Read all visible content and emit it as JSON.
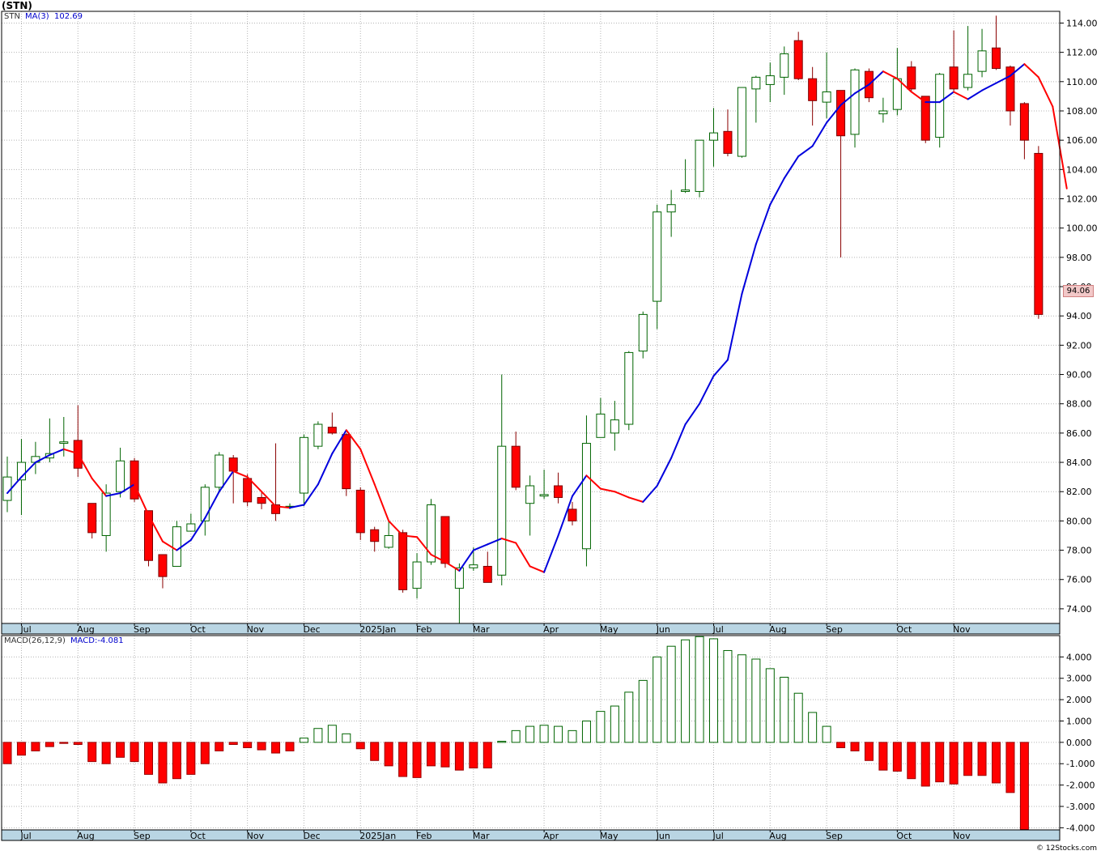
{
  "symbol": "(STN)",
  "footer": "© 12Stocks.com",
  "colors": {
    "up_outline": "#006400",
    "down_fill": "#ff0000",
    "ma_up": "#0000dd",
    "ma_down": "#ff0000",
    "grid": "#b4b4b4",
    "axis_strip": "#b9d5e3",
    "last_price_box": "#f2c8c8"
  },
  "price_panel": {
    "ticker_label": "STN",
    "ma_label": "MA(3)",
    "ma_value": "102.69",
    "last_price_label": "94.06",
    "y_ticks": [
      "74.00",
      "76.00",
      "78.00",
      "80.00",
      "82.00",
      "84.00",
      "86.00",
      "88.00",
      "90.00",
      "92.00",
      "94.00",
      "96.00",
      "98.00",
      "100.00",
      "102.00",
      "104.00",
      "106.00",
      "108.00",
      "110.00",
      "112.00",
      "114.00"
    ]
  },
  "macd_panel": {
    "label": "MACD(26,12,9)",
    "value_label": "MACD:-4.081",
    "y_ticks": [
      "-4.000",
      "-3.000",
      "-2.000",
      "-1.000",
      "0.000",
      "1.000",
      "2.000",
      "3.000",
      "4.000"
    ]
  },
  "x_axis": {
    "months": [
      "Jul",
      "Aug",
      "Sep",
      "Oct",
      "Nov",
      "Dec",
      "2025Jan",
      "Feb",
      "Mar",
      "Apr",
      "May",
      "Jun",
      "Jul",
      "Aug",
      "Sep",
      "Oct",
      "Nov"
    ],
    "month_week_index": [
      1,
      5,
      9,
      13,
      17,
      21,
      25,
      29,
      33,
      38,
      42,
      46,
      50,
      54,
      58,
      63,
      67
    ]
  },
  "chart_data": {
    "type": "candlestick",
    "title": "(STN)",
    "interval": "weekly",
    "ylim": [
      73,
      114.8
    ],
    "macd_ylim": [
      -4.1,
      5.0
    ],
    "candles": [
      {
        "o": 81.4,
        "h": 84.4,
        "l": 80.6,
        "c": 83.0
      },
      {
        "o": 82.8,
        "h": 85.6,
        "l": 80.4,
        "c": 84.0
      },
      {
        "o": 84.0,
        "h": 85.4,
        "l": 83.2,
        "c": 84.4
      },
      {
        "o": 84.3,
        "h": 87.0,
        "l": 84.0,
        "c": 84.6
      },
      {
        "o": 85.3,
        "h": 87.1,
        "l": 84.4,
        "c": 85.4
      },
      {
        "o": 85.5,
        "h": 87.9,
        "l": 83.0,
        "c": 83.6
      },
      {
        "o": 81.2,
        "h": 81.2,
        "l": 78.8,
        "c": 79.2
      },
      {
        "o": 79.0,
        "h": 82.5,
        "l": 77.9,
        "c": 81.9
      },
      {
        "o": 82.0,
        "h": 85.0,
        "l": 81.6,
        "c": 84.1
      },
      {
        "o": 84.1,
        "h": 84.3,
        "l": 81.3,
        "c": 81.5
      },
      {
        "o": 80.7,
        "h": 80.7,
        "l": 76.9,
        "c": 77.3
      },
      {
        "o": 77.7,
        "h": 77.7,
        "l": 75.4,
        "c": 76.2
      },
      {
        "o": 76.9,
        "h": 80.0,
        "l": 76.9,
        "c": 79.6
      },
      {
        "o": 79.3,
        "h": 80.5,
        "l": 79.3,
        "c": 79.8
      },
      {
        "o": 80.0,
        "h": 82.5,
        "l": 79.0,
        "c": 82.3
      },
      {
        "o": 82.3,
        "h": 84.7,
        "l": 82.0,
        "c": 84.5
      },
      {
        "o": 84.3,
        "h": 84.5,
        "l": 81.2,
        "c": 83.4
      },
      {
        "o": 82.9,
        "h": 83.2,
        "l": 81.0,
        "c": 81.3
      },
      {
        "o": 81.6,
        "h": 82.0,
        "l": 80.8,
        "c": 81.2
      },
      {
        "o": 81.1,
        "h": 85.3,
        "l": 80.0,
        "c": 80.5
      },
      {
        "o": 81.0,
        "h": 81.2,
        "l": 80.8,
        "c": 81.0
      },
      {
        "o": 81.9,
        "h": 85.9,
        "l": 81.0,
        "c": 85.7
      },
      {
        "o": 85.1,
        "h": 86.8,
        "l": 84.9,
        "c": 86.6
      },
      {
        "o": 86.4,
        "h": 87.4,
        "l": 85.9,
        "c": 86.0
      },
      {
        "o": 85.9,
        "h": 86.0,
        "l": 81.7,
        "c": 82.2
      },
      {
        "o": 82.1,
        "h": 82.3,
        "l": 78.7,
        "c": 79.2
      },
      {
        "o": 79.4,
        "h": 79.6,
        "l": 77.9,
        "c": 78.6
      },
      {
        "o": 78.2,
        "h": 80.0,
        "l": 78.1,
        "c": 79.0
      },
      {
        "o": 79.2,
        "h": 79.4,
        "l": 75.1,
        "c": 75.3
      },
      {
        "o": 75.4,
        "h": 77.8,
        "l": 74.7,
        "c": 77.2
      },
      {
        "o": 77.2,
        "h": 81.5,
        "l": 77.0,
        "c": 81.1
      },
      {
        "o": 80.3,
        "h": 80.3,
        "l": 76.8,
        "c": 77.1
      },
      {
        "o": 75.4,
        "h": 77.1,
        "l": 73.0,
        "c": 76.8
      },
      {
        "o": 76.8,
        "h": 78.2,
        "l": 76.6,
        "c": 77.0
      },
      {
        "o": 76.9,
        "h": 77.9,
        "l": 75.8,
        "c": 75.8
      },
      {
        "o": 76.3,
        "h": 90.0,
        "l": 75.6,
        "c": 85.1
      },
      {
        "o": 85.1,
        "h": 86.1,
        "l": 82.1,
        "c": 82.3
      },
      {
        "o": 81.2,
        "h": 83.1,
        "l": 79.0,
        "c": 82.4
      },
      {
        "o": 81.7,
        "h": 83.5,
        "l": 81.5,
        "c": 81.8
      },
      {
        "o": 82.4,
        "h": 83.3,
        "l": 81.2,
        "c": 81.6
      },
      {
        "o": 80.8,
        "h": 81.3,
        "l": 79.7,
        "c": 80.0
      },
      {
        "o": 78.1,
        "h": 87.2,
        "l": 76.9,
        "c": 85.3
      },
      {
        "o": 85.7,
        "h": 88.4,
        "l": 85.7,
        "c": 87.3
      },
      {
        "o": 86.0,
        "h": 88.2,
        "l": 84.8,
        "c": 86.9
      },
      {
        "o": 86.6,
        "h": 91.6,
        "l": 86.2,
        "c": 91.5
      },
      {
        "o": 91.6,
        "h": 94.3,
        "l": 91.1,
        "c": 94.1
      },
      {
        "o": 95.0,
        "h": 101.6,
        "l": 93.1,
        "c": 101.1
      },
      {
        "o": 101.1,
        "h": 102.6,
        "l": 99.4,
        "c": 101.6
      },
      {
        "o": 102.5,
        "h": 104.7,
        "l": 102.4,
        "c": 102.6
      },
      {
        "o": 102.5,
        "h": 106.0,
        "l": 102.1,
        "c": 106.0
      },
      {
        "o": 106.0,
        "h": 108.2,
        "l": 104.2,
        "c": 106.5
      },
      {
        "o": 106.6,
        "h": 108.1,
        "l": 104.9,
        "c": 105.1
      },
      {
        "o": 104.9,
        "h": 109.6,
        "l": 104.8,
        "c": 109.6
      },
      {
        "o": 109.5,
        "h": 110.4,
        "l": 107.2,
        "c": 110.3
      },
      {
        "o": 109.8,
        "h": 111.3,
        "l": 108.6,
        "c": 110.4
      },
      {
        "o": 110.3,
        "h": 112.4,
        "l": 109.1,
        "c": 111.9
      },
      {
        "o": 112.8,
        "h": 113.4,
        "l": 110.1,
        "c": 110.2
      },
      {
        "o": 110.2,
        "h": 111.0,
        "l": 107.0,
        "c": 108.7
      },
      {
        "o": 108.6,
        "h": 112.0,
        "l": 107.5,
        "c": 109.3
      },
      {
        "o": 109.4,
        "h": 109.4,
        "l": 98.0,
        "c": 106.3
      },
      {
        "o": 106.4,
        "h": 110.9,
        "l": 105.5,
        "c": 110.8
      },
      {
        "o": 110.7,
        "h": 110.9,
        "l": 108.6,
        "c": 108.9
      },
      {
        "o": 107.8,
        "h": 108.9,
        "l": 107.2,
        "c": 108.0
      },
      {
        "o": 108.1,
        "h": 112.3,
        "l": 107.7,
        "c": 110.2
      },
      {
        "o": 111.0,
        "h": 111.4,
        "l": 109.3,
        "c": 109.5
      },
      {
        "o": 109.0,
        "h": 109.0,
        "l": 105.8,
        "c": 106.0
      },
      {
        "o": 106.2,
        "h": 110.6,
        "l": 105.5,
        "c": 110.5
      },
      {
        "o": 111.0,
        "h": 113.5,
        "l": 109.3,
        "c": 109.5
      },
      {
        "o": 109.6,
        "h": 113.8,
        "l": 109.4,
        "c": 110.5
      },
      {
        "o": 110.7,
        "h": 113.6,
        "l": 110.3,
        "c": 112.1
      },
      {
        "o": 112.3,
        "h": 114.5,
        "l": 110.8,
        "c": 110.9
      },
      {
        "o": 111.0,
        "h": 111.1,
        "l": 107.0,
        "c": 108.0
      },
      {
        "o": 108.5,
        "h": 108.6,
        "l": 104.7,
        "c": 106.0
      },
      {
        "o": 105.1,
        "h": 105.6,
        "l": 93.8,
        "c": 94.1
      }
    ],
    "ma3": [
      81.9,
      83.0,
      84.0,
      84.5,
      84.9,
      84.6,
      82.9,
      81.7,
      81.9,
      82.5,
      80.4,
      78.6,
      78.0,
      78.7,
      80.2,
      82.0,
      83.4,
      83.0,
      82.0,
      81.0,
      80.9,
      81.1,
      82.5,
      84.6,
      86.2,
      84.9,
      82.5,
      80.0,
      79.0,
      78.9,
      77.7,
      77.2,
      76.6,
      78.0,
      78.4,
      78.8,
      78.5,
      76.9,
      76.5,
      79.0,
      81.7,
      83.1,
      82.2,
      82.0,
      81.6,
      81.3,
      82.4,
      84.3,
      86.6,
      88.0,
      89.9,
      91.0,
      95.5,
      98.9,
      101.6,
      103.4,
      104.9,
      105.6,
      107.2,
      108.4,
      109.2,
      109.8,
      110.7,
      110.2,
      109.3,
      108.6,
      108.6,
      109.3,
      108.8,
      109.4,
      109.9,
      110.4,
      111.2,
      110.3,
      108.3,
      102.7
    ],
    "macd": [
      -1.0,
      -0.6,
      -0.4,
      -0.2,
      -0.05,
      -0.1,
      -0.9,
      -1.0,
      -0.7,
      -0.9,
      -1.5,
      -1.9,
      -1.7,
      -1.5,
      -1.0,
      -0.4,
      -0.1,
      -0.25,
      -0.35,
      -0.5,
      -0.4,
      0.2,
      0.65,
      0.8,
      0.4,
      -0.3,
      -0.85,
      -1.1,
      -1.6,
      -1.65,
      -1.1,
      -1.15,
      -1.3,
      -1.2,
      -1.2,
      0.05,
      0.55,
      0.75,
      0.8,
      0.75,
      0.55,
      1.0,
      1.45,
      1.7,
      2.35,
      2.9,
      4.0,
      4.5,
      4.8,
      4.95,
      4.85,
      4.3,
      4.1,
      3.9,
      3.45,
      3.05,
      2.3,
      1.4,
      0.75,
      -0.25,
      -0.4,
      -0.85,
      -1.3,
      -1.35,
      -1.7,
      -2.05,
      -1.85,
      -1.95,
      -1.55,
      -1.55,
      -1.9,
      -2.35,
      -4.08
    ]
  }
}
